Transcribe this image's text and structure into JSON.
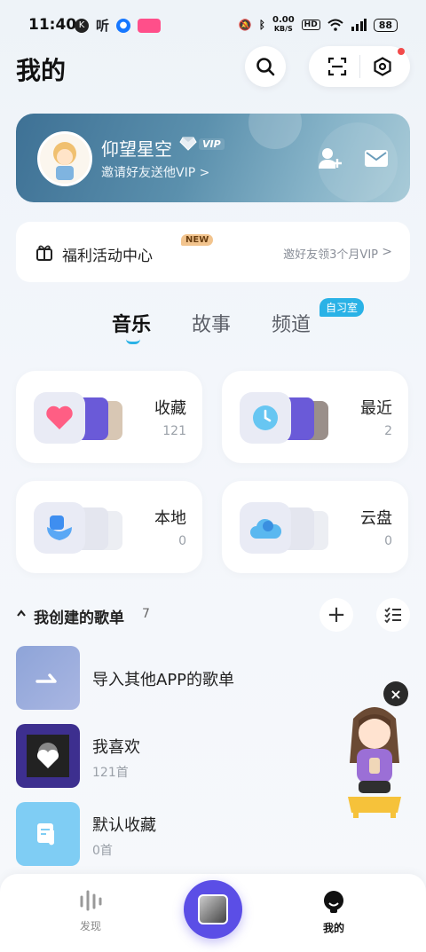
{
  "status": {
    "time": "11:40",
    "net_speed_top": "0.00",
    "net_speed_bottom": "KB/S",
    "hd": "HD",
    "battery": "88",
    "left_icon_1": "K",
    "left_icon_2": "听"
  },
  "header": {
    "title": "我的"
  },
  "profile": {
    "name": "仰望星空",
    "vip": "VIP",
    "invite": "邀请好友送他VIP >"
  },
  "welfare": {
    "title": "福利活动中心",
    "badge": "NEW",
    "subtitle": "邀好友领3个月VIP",
    "chevron": ">"
  },
  "tabs": [
    {
      "label": "音乐"
    },
    {
      "label": "故事"
    },
    {
      "label": "频道"
    }
  ],
  "tab_badge": "自习室",
  "cards": [
    {
      "label": "收藏",
      "count": "121"
    },
    {
      "label": "最近",
      "count": "2"
    },
    {
      "label": "本地",
      "count": "0"
    },
    {
      "label": "云盘",
      "count": "0"
    }
  ],
  "section": {
    "title": "我创建的歌单",
    "count": "7",
    "add": "+"
  },
  "playlists": [
    {
      "name": "导入其他APP的歌单",
      "sub": ""
    },
    {
      "name": "我喜欢",
      "sub": "121首"
    },
    {
      "name": "默认收藏",
      "sub": "0首"
    }
  ],
  "float": {
    "close": "×"
  },
  "nav": [
    {
      "label": "发现"
    },
    {
      "label": "我的"
    }
  ],
  "colors": {
    "accent": "#2ab2e6",
    "play": "#5b4ee6",
    "new_badge": "#f2c48e"
  }
}
